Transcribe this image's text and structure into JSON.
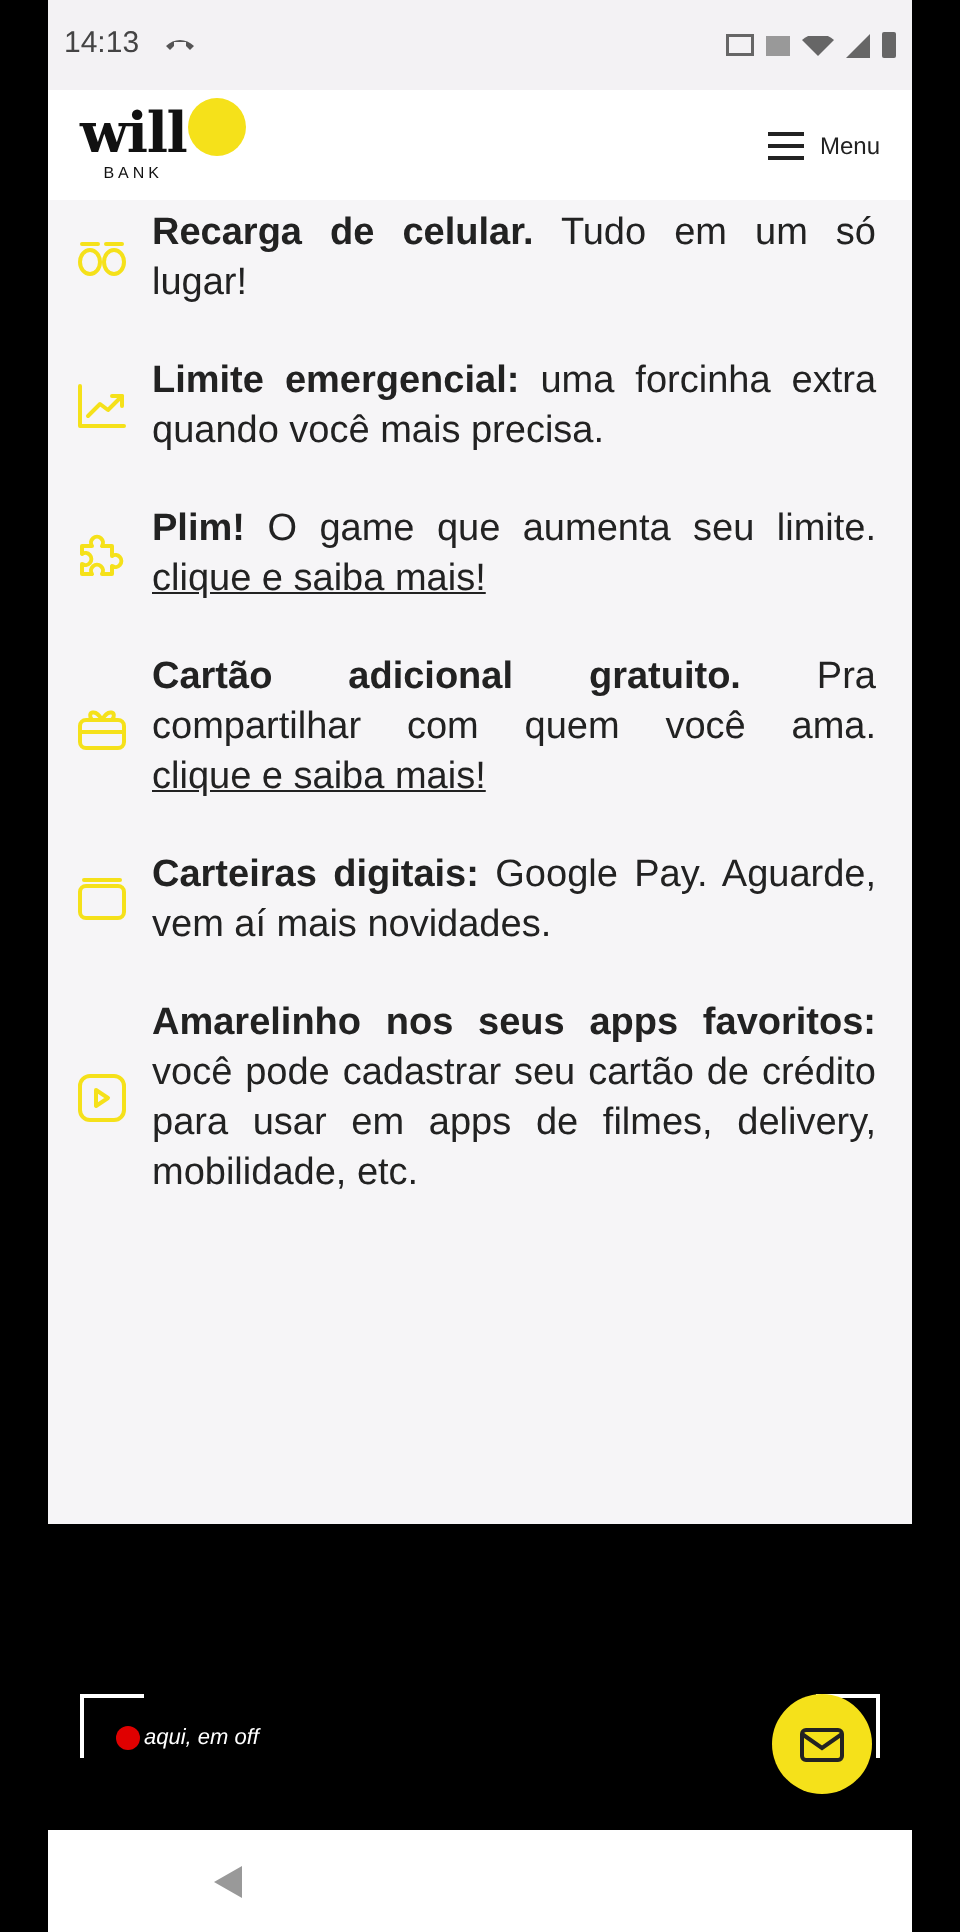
{
  "status_bar": {
    "time": "14:13"
  },
  "header": {
    "logo": "will",
    "logo_sub": "BANK",
    "menu": "Menu"
  },
  "features": [
    {
      "lead": "Recarga de celular.",
      "text": "Tudo em um só lugar!"
    },
    {
      "lead": "Limite emergencial:",
      "text": "uma forcinha extra quando você mais precisa."
    },
    {
      "lead": "Plim!",
      "text": "O game que aumenta seu limite.",
      "link": "clique e saiba mais!"
    },
    {
      "lead": "Cartão adicional gratuito.",
      "text": "Pra compartilhar com quem você ama.",
      "link": "clique e saiba mais!"
    },
    {
      "lead": "Carteiras digitais:",
      "text": "Google Pay. Aguarde, vem aí mais novidades."
    },
    {
      "lead": "Amarelinho nos seus apps favoritos:",
      "text": "você pode cadastrar seu cartão de crédito para usar em apps de filmes, delivery, mobilidade, etc."
    }
  ],
  "overlay": {
    "label": "aqui, em off"
  }
}
